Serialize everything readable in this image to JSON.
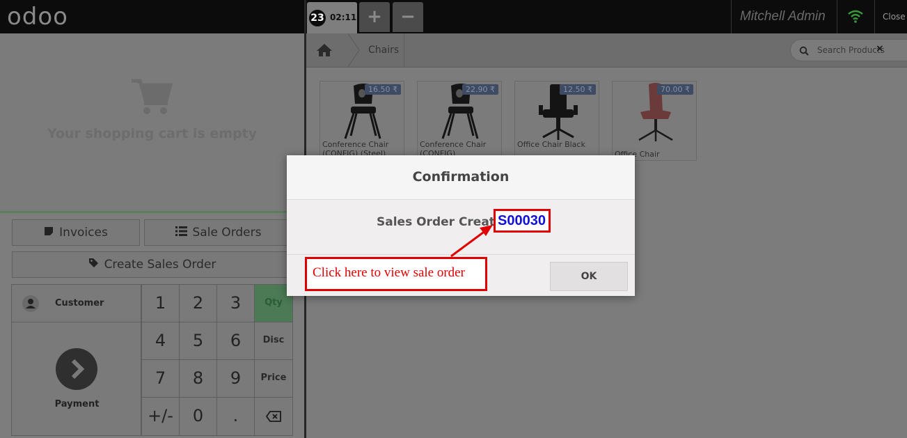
{
  "topbar": {
    "logo": "odoo",
    "order_number": "23",
    "order_time": "02:11",
    "add_label": "+",
    "remove_label": "−",
    "user": "Mitchell Admin",
    "close_label": "Close",
    "wifi_icon": "wifi-icon"
  },
  "cart": {
    "empty_text": "Your shopping cart is empty",
    "icon": "cart-icon"
  },
  "actions": {
    "invoices": "Invoices",
    "sale_orders": "Sale Orders",
    "create_sales_order": "Create Sales Order"
  },
  "numpad": {
    "customer": "Customer",
    "payment": "Payment",
    "digits": [
      "1",
      "2",
      "3",
      "4",
      "5",
      "6",
      "7",
      "8",
      "9",
      "+/-",
      "0",
      "."
    ],
    "modes": [
      "Qty",
      "Disc",
      "Price"
    ],
    "active_mode": "Qty"
  },
  "breadcrumb": {
    "category": "Chairs"
  },
  "search": {
    "placeholder": "Search Products"
  },
  "products": [
    {
      "name": "Conference Chair (CONFIG) (Steel)",
      "price": "16.50 ₹"
    },
    {
      "name": "Conference Chair (CONFIG) (Aluminium)",
      "price": "22.90 ₹"
    },
    {
      "name": "Office Chair Black",
      "price": "12.50 ₹"
    },
    {
      "name": "Office Chair",
      "price": "70.00 ₹"
    }
  ],
  "modal": {
    "title": "Confirmation",
    "created_label": "Sales Order Created:",
    "order_ref": "S00030",
    "ok_label": "OK"
  },
  "annotation": {
    "text": "Click here to view sale order"
  },
  "colors": {
    "accent_green": "#4b7a55",
    "annotation_red": "#e00000",
    "link_blue": "#1010d8"
  }
}
